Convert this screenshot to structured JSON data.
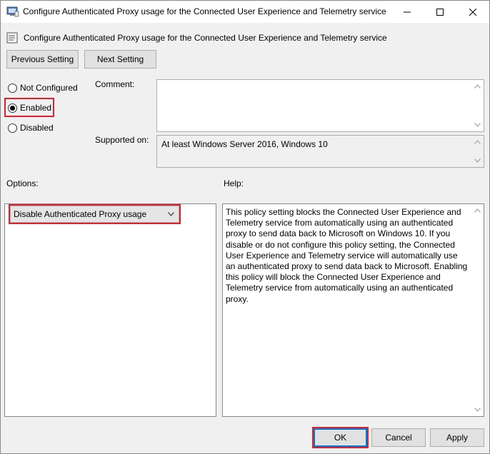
{
  "window": {
    "title": "Configure Authenticated Proxy usage for the Connected User Experience and Telemetry service",
    "icon": "policy-icon"
  },
  "header": {
    "title": "Configure Authenticated Proxy usage for the Connected User Experience and Telemetry service",
    "icon": "policy-setting-icon"
  },
  "nav": {
    "previous_label": "Previous Setting",
    "next_label": "Next Setting"
  },
  "state": {
    "options": [
      {
        "label": "Not Configured",
        "selected": false
      },
      {
        "label": "Enabled",
        "selected": true
      },
      {
        "label": "Disabled",
        "selected": false
      }
    ]
  },
  "comment": {
    "label": "Comment:",
    "value": ""
  },
  "supported": {
    "label": "Supported on:",
    "value": "At least Windows Server 2016, Windows 10"
  },
  "options_section": {
    "label": "Options:",
    "dropdown_value": "Disable Authenticated Proxy usage"
  },
  "help_section": {
    "label": "Help:",
    "text": "This policy setting blocks the Connected User Experience and Telemetry service from automatically using an authenticated proxy to send data back to Microsoft on Windows 10. If you disable or do not configure this policy setting, the Connected User Experience and Telemetry service will automatically use an authenticated proxy to send data back to Microsoft. Enabling this policy will block the Connected User Experience and Telemetry service from automatically using an authenticated proxy."
  },
  "footer": {
    "ok_label": "OK",
    "cancel_label": "Cancel",
    "apply_label": "Apply"
  },
  "colors": {
    "highlight": "#e0202a",
    "accent": "#0078d7"
  }
}
